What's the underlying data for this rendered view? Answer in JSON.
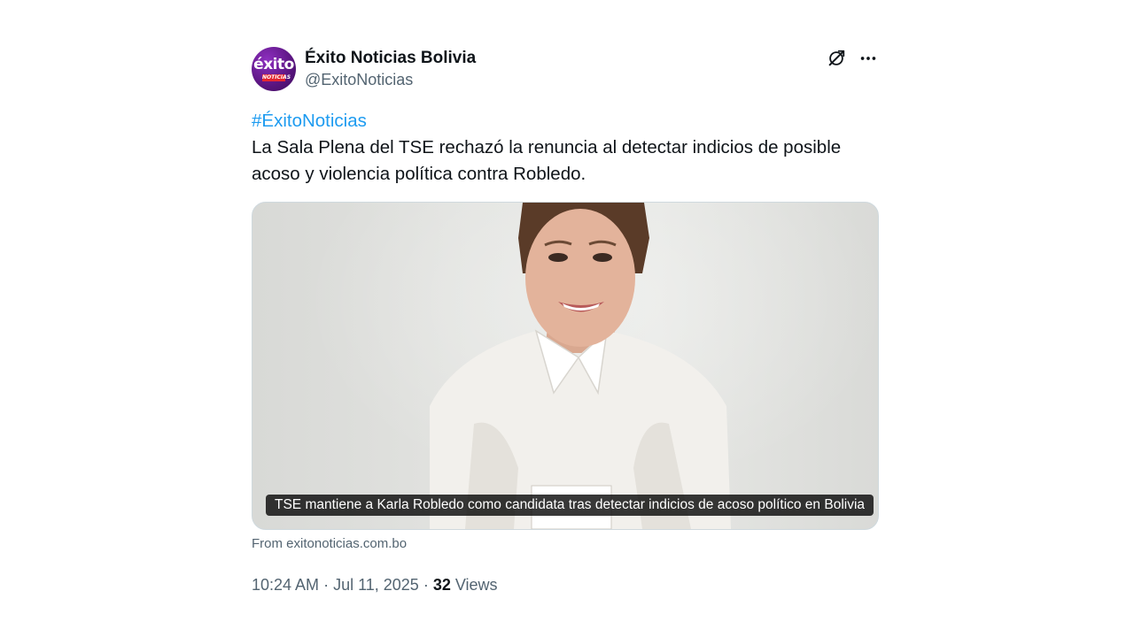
{
  "author": {
    "avatar_text": "éxito",
    "avatar_subtext": "NOTICIAS",
    "display_name": "Éxito Noticias Bolivia",
    "handle": "@ExitoNoticias"
  },
  "header_icons": [
    "grok-icon",
    "more-options-icon"
  ],
  "tweet": {
    "hashtag": "#ÉxitoNoticias",
    "text": "La Sala Plena del TSE rechazó la renuncia al detectar indicios de posible acoso y violencia política contra Robledo."
  },
  "card": {
    "caption": "TSE mantiene a Karla Robledo como candidata tras detectar indicios de acoso político en Bolivia",
    "source": "From exitonoticias.com.bo"
  },
  "meta": {
    "time": "10:24 AM",
    "sep1": " · ",
    "date": "Jul 11, 2025",
    "sep2": " · ",
    "views_count": "32",
    "views_label": " Views"
  },
  "colors": {
    "accent": "#1d9bf0",
    "secondary_text": "#536471",
    "primary_text": "#0f1419"
  }
}
